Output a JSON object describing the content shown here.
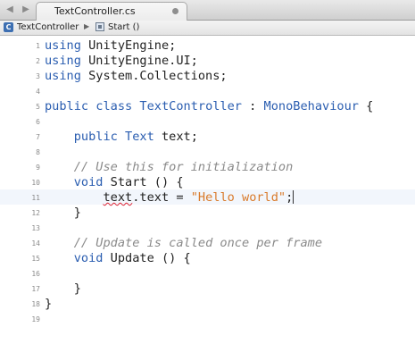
{
  "tab": {
    "title": "TextController.cs"
  },
  "breadcrumb": {
    "class_name": "TextController",
    "method_name": "Start ()"
  },
  "colors": {
    "keyword": "#2a5db0",
    "comment": "#8a8a8a",
    "string": "#d97a2a"
  },
  "icons": {
    "back": "arrow-left-icon",
    "forward": "arrow-right-icon",
    "class": "csharp-class-icon",
    "method": "method-icon",
    "close": "close-icon"
  },
  "lines": [
    {
      "n": "1",
      "tokens": [
        {
          "t": "using",
          "c": "kw"
        },
        {
          "t": " UnityEngine;"
        }
      ]
    },
    {
      "n": "2",
      "tokens": [
        {
          "t": "using",
          "c": "kw"
        },
        {
          "t": " UnityEngine.UI;"
        }
      ]
    },
    {
      "n": "3",
      "tokens": [
        {
          "t": "using",
          "c": "kw"
        },
        {
          "t": " System.Collections;"
        }
      ]
    },
    {
      "n": "4",
      "tokens": []
    },
    {
      "n": "5",
      "tokens": [
        {
          "t": "public",
          "c": "kw"
        },
        {
          "t": " "
        },
        {
          "t": "class",
          "c": "kw"
        },
        {
          "t": " "
        },
        {
          "t": "TextController",
          "c": "ty"
        },
        {
          "t": " : "
        },
        {
          "t": "MonoBehaviour",
          "c": "ty"
        },
        {
          "t": " {"
        }
      ]
    },
    {
      "n": "6",
      "tokens": []
    },
    {
      "n": "7",
      "tokens": [
        {
          "t": "    "
        },
        {
          "t": "public",
          "c": "kw"
        },
        {
          "t": " "
        },
        {
          "t": "Text",
          "c": "ty"
        },
        {
          "t": " text;"
        }
      ]
    },
    {
      "n": "8",
      "tokens": []
    },
    {
      "n": "9",
      "tokens": [
        {
          "t": "    "
        },
        {
          "t": "// Use this for initialization",
          "c": "cm"
        }
      ]
    },
    {
      "n": "10",
      "tokens": [
        {
          "t": "    "
        },
        {
          "t": "void",
          "c": "kw"
        },
        {
          "t": " Start () {"
        }
      ]
    },
    {
      "n": "11",
      "current": true,
      "tokens": [
        {
          "t": "        "
        },
        {
          "t": "text",
          "c": "squig"
        },
        {
          "t": ".text = "
        },
        {
          "t": "\"Hello world\"",
          "c": "st"
        },
        {
          "t": ";"
        },
        {
          "t": "",
          "c": "caret"
        }
      ]
    },
    {
      "n": "12",
      "tokens": [
        {
          "t": "    }"
        }
      ]
    },
    {
      "n": "13",
      "tokens": []
    },
    {
      "n": "14",
      "tokens": [
        {
          "t": "    "
        },
        {
          "t": "// Update is called once per frame",
          "c": "cm"
        }
      ]
    },
    {
      "n": "15",
      "tokens": [
        {
          "t": "    "
        },
        {
          "t": "void",
          "c": "kw"
        },
        {
          "t": " Update () {"
        }
      ]
    },
    {
      "n": "16",
      "tokens": []
    },
    {
      "n": "17",
      "tokens": [
        {
          "t": "    }"
        }
      ]
    },
    {
      "n": "18",
      "tokens": [
        {
          "t": "}"
        }
      ]
    },
    {
      "n": "19",
      "tokens": []
    }
  ]
}
